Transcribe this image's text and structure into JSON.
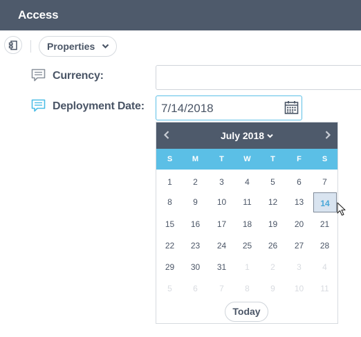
{
  "header": {
    "title": "Access"
  },
  "toolbar": {
    "properties_label": "Properties"
  },
  "fields": {
    "currency": {
      "label": "Currency:",
      "value": ""
    },
    "deployment_date": {
      "label": "Deployment Date:",
      "value": "7/14/2018"
    }
  },
  "calendar": {
    "month_label": "July 2018",
    "weekdays": [
      "S",
      "M",
      "T",
      "W",
      "T",
      "F",
      "S"
    ],
    "weeks": [
      [
        "1",
        "2",
        "3",
        "4",
        "5",
        "6",
        "7"
      ],
      [
        "8",
        "9",
        "10",
        "11",
        "12",
        "13",
        "14"
      ],
      [
        "15",
        "16",
        "17",
        "18",
        "19",
        "20",
        "21"
      ],
      [
        "22",
        "23",
        "24",
        "25",
        "26",
        "27",
        "28"
      ],
      [
        "29",
        "30",
        "31",
        "1",
        "2",
        "3",
        "4"
      ],
      [
        "5",
        "6",
        "7",
        "8",
        "9",
        "10",
        "11"
      ]
    ],
    "selected_day": "14",
    "today_label": "Today"
  },
  "colors": {
    "header_bg": "#4e5a6b",
    "accent": "#5bbfe6",
    "selected_bg": "#d9e4f0"
  }
}
